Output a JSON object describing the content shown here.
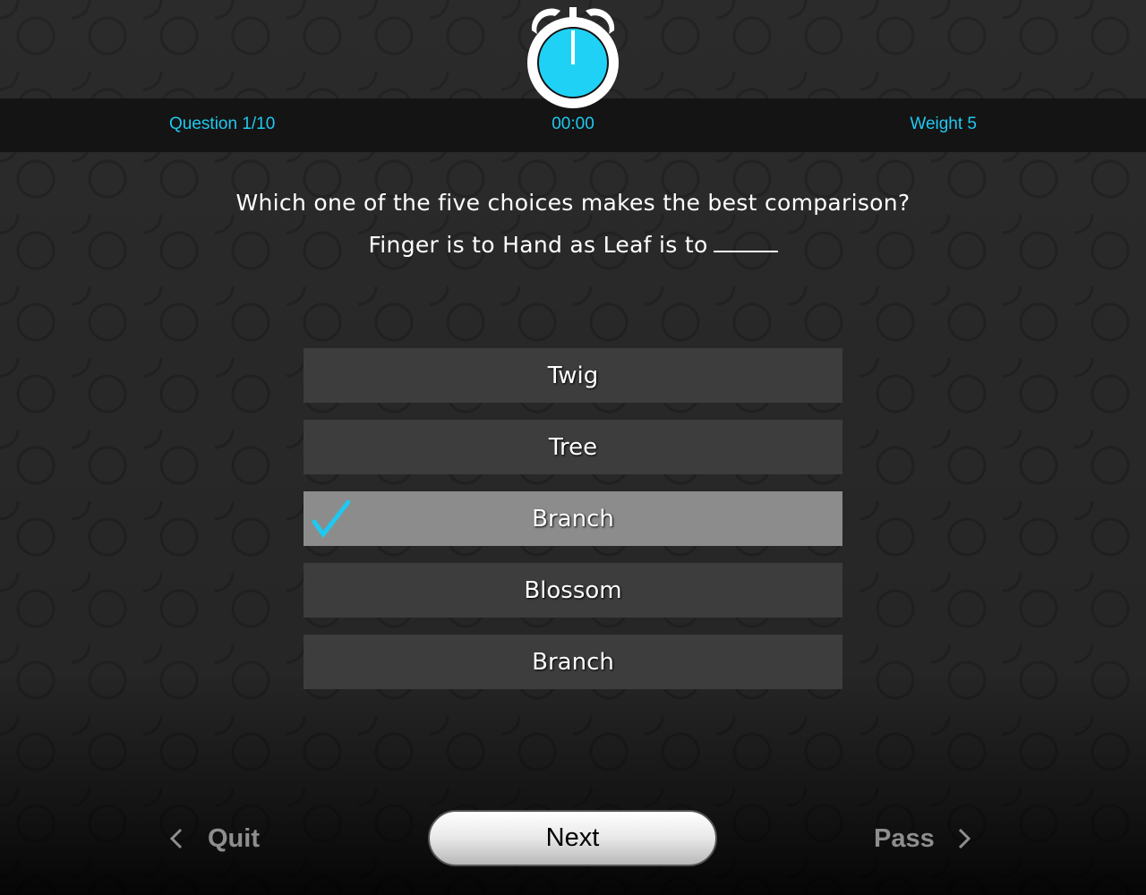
{
  "header": {
    "question_counter": "Question 1/10",
    "timer": "00:00",
    "weight": "Weight 5"
  },
  "question": {
    "prompt": "Which one of the five choices makes the best comparison?",
    "stem": "Finger is to Hand as Leaf is to"
  },
  "choices": [
    {
      "label": "Twig",
      "selected": false
    },
    {
      "label": "Tree",
      "selected": false
    },
    {
      "label": "Branch",
      "selected": true
    },
    {
      "label": "Blossom",
      "selected": false
    },
    {
      "label": "Branch",
      "selected": false
    }
  ],
  "footer": {
    "quit_label": "Quit",
    "next_label": "Next",
    "pass_label": "Pass"
  },
  "colors": {
    "accent": "#1fc8f0",
    "selected_bg": "#8c8c8c",
    "choice_bg": "#3d3d3d"
  },
  "icons": {
    "timer": "alarm-clock-icon",
    "selected": "checkmark-icon",
    "back": "chevron-left-icon",
    "forward": "chevron-right-icon"
  }
}
